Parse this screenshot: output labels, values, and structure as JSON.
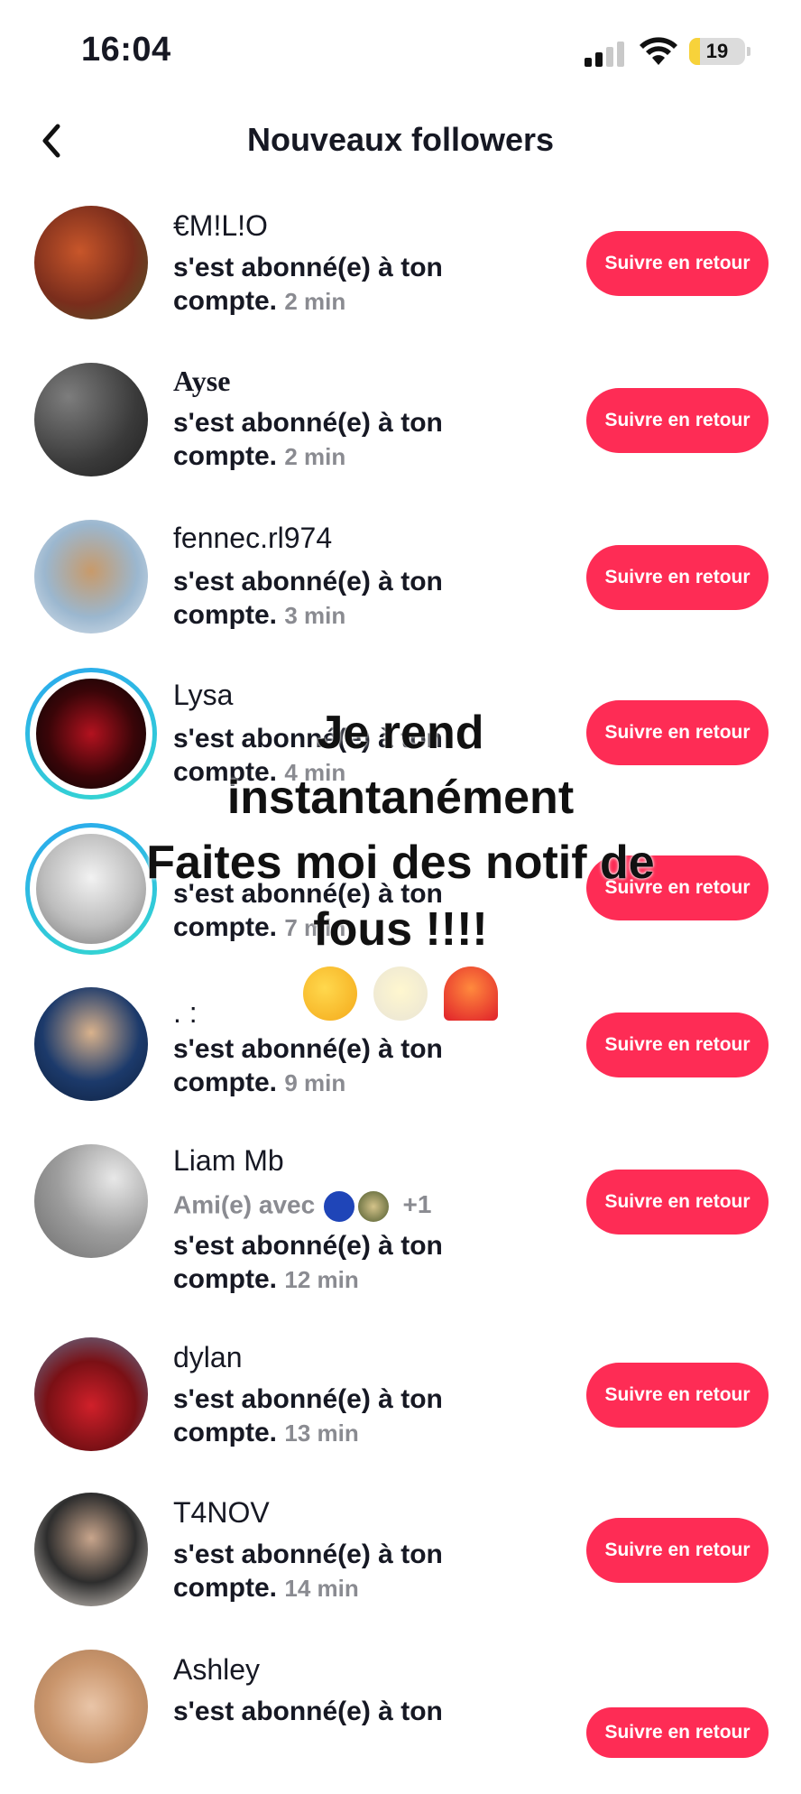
{
  "status_bar": {
    "time": "16:04",
    "battery_level": "19"
  },
  "header": {
    "title": "Nouveaux followers"
  },
  "followers": [
    {
      "name": "€M!L!O",
      "desc": "s'est abonné(e) à ton compte.",
      "time": "2 min"
    },
    {
      "name": "Ayse",
      "desc": "s'est abonné(e) à ton compte.",
      "time": "2 min"
    },
    {
      "name": "fennec.rl974",
      "desc": "s'est abonné(e) à ton compte.",
      "time": "3 min"
    },
    {
      "name": "Lysa",
      "desc": "s'est abonné(e) à ton compte.",
      "time": "4 min"
    },
    {
      "name": "",
      "desc": "s'est abonné(e) à ton compte.",
      "time": "7 min"
    },
    {
      "name": ". :",
      "desc": "s'est abonné(e) à ton compte.",
      "time": "9 min"
    },
    {
      "name": "Liam Mb",
      "friends": "Ami(e) avec",
      "friends_more": "+1",
      "desc": "s'est abonné(e) à ton compte.",
      "time": "12 min"
    },
    {
      "name": "dylan",
      "desc": "s'est abonné(e) à ton compte.",
      "time": "13 min"
    },
    {
      "name": "T4NOV",
      "desc": "s'est abonné(e) à ton compte.",
      "time": "14 min"
    },
    {
      "name": "Ashley",
      "desc": "s'est abonné(e) à ton",
      "time": ""
    }
  ],
  "follow_back_label": "Suivre en retour",
  "overlay": {
    "line1": "Je rend",
    "line2": "instantanément",
    "line3": "Faites moi des notif de",
    "line4": "fous !!!!"
  },
  "colors": {
    "accent": "#fe2c55",
    "ring_start": "#2aa8ee",
    "ring_end": "#35d8d0"
  }
}
